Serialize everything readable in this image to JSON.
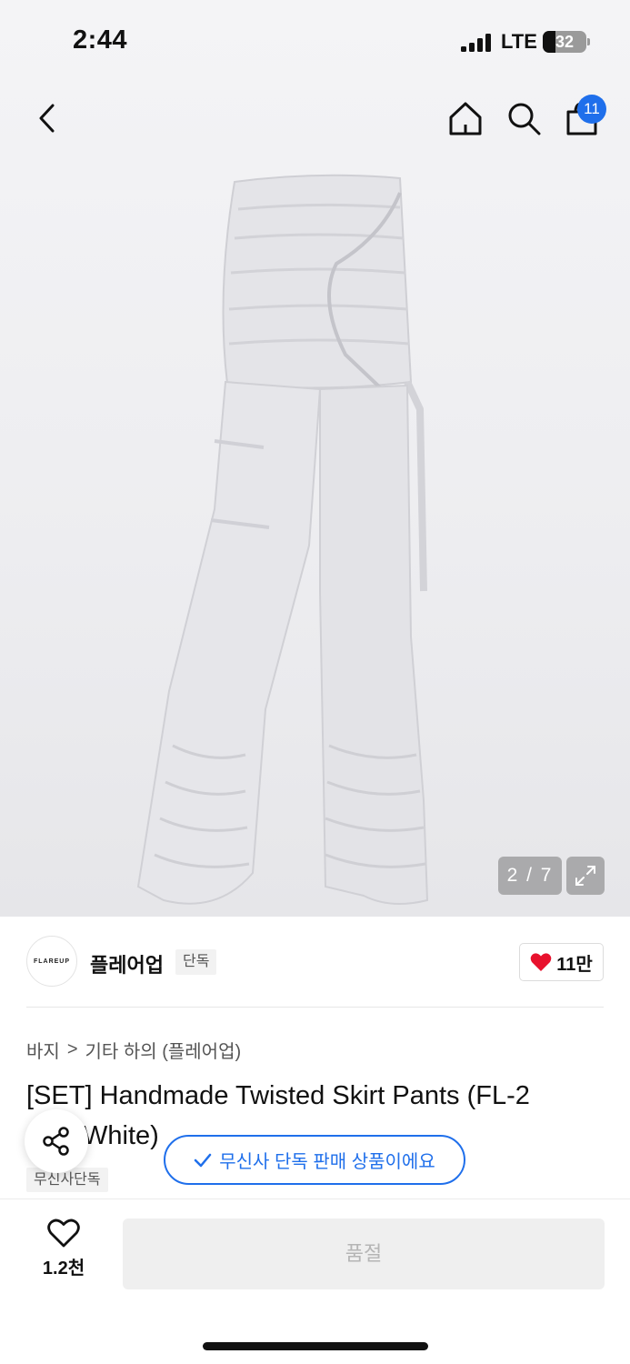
{
  "status_bar": {
    "time": "2:44",
    "network": "LTE",
    "battery": "32"
  },
  "header": {
    "back_icon": "chevron-left-icon",
    "home_icon": "home-icon",
    "search_icon": "search-icon",
    "cart_icon": "shopping-bag-icon",
    "cart_count": "11"
  },
  "gallery": {
    "indicator": "2 / 7",
    "expand_icon": "expand-icon"
  },
  "brand": {
    "logo_text": "FLAREUP",
    "name": "플레어업",
    "tag": "단독",
    "likes": "11만"
  },
  "breadcrumb": {
    "category": "바지",
    "separator": ">",
    "subcategory": "기타 하의 (플레어업)"
  },
  "product": {
    "title": "[SET] Handmade Twisted Skirt Pants (FL-2",
    "title_line2": "White)",
    "badge": "무신사단독",
    "exclusive_notice": "무신사 단독 판매 상품이에요"
  },
  "bottom_bar": {
    "wish_count": "1.2천",
    "soldout_label": "품절"
  },
  "colors": {
    "accent": "#1f6feb",
    "heart": "#e8112d"
  }
}
